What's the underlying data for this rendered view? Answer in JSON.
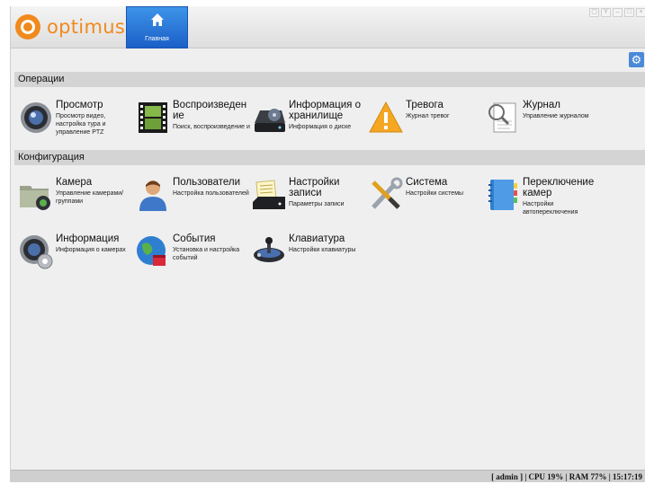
{
  "header": {
    "logo_text": "optimus",
    "home_tab_label": "Главная",
    "window_controls": [
      "lock",
      "restart",
      "minimize",
      "maximize",
      "close"
    ]
  },
  "sections": {
    "operations": "Операции",
    "configuration": "Конфигурация"
  },
  "operations": [
    {
      "title": "Просмотр",
      "desc": "Просмотр видео, настройка тура и управление PTZ",
      "icon": "camera-lens-icon"
    },
    {
      "title": "Воспроизведен ие",
      "desc": "Поиск, воспроизведение и",
      "icon": "film-strip-icon"
    },
    {
      "title": "Информация о хранилище",
      "desc": "Информация о диске",
      "icon": "hard-drive-icon"
    },
    {
      "title": "Тревога",
      "desc": "Журнал тревог",
      "icon": "warning-icon"
    },
    {
      "title": "Журнал",
      "desc": "Управление журналом",
      "icon": "magnifier-document-icon"
    }
  ],
  "configuration": [
    {
      "title": "Камера",
      "desc": "Управление камерами/группами",
      "icon": "camera-folder-icon"
    },
    {
      "title": "Пользователи",
      "desc": "Настройка пользователей",
      "icon": "user-icon"
    },
    {
      "title": "Настройки записи",
      "desc": "Параметры записи",
      "icon": "recording-settings-icon"
    },
    {
      "title": "Система",
      "desc": "Настройки системы",
      "icon": "tools-icon"
    },
    {
      "title": "Переключение камер",
      "desc": "Настройки автопереключения",
      "icon": "notebook-icon"
    },
    {
      "title": "Информация",
      "desc": "Информация о камерах",
      "icon": "camera-info-icon"
    },
    {
      "title": "События",
      "desc": "Установка и настройка событий",
      "icon": "globe-events-icon"
    },
    {
      "title": "Клавиатура",
      "desc": "Настройки клавиатуры",
      "icon": "joystick-icon"
    }
  ],
  "status": {
    "text": "[ admin ] | CPU 19% | RAM 77% | 15:17:19"
  }
}
